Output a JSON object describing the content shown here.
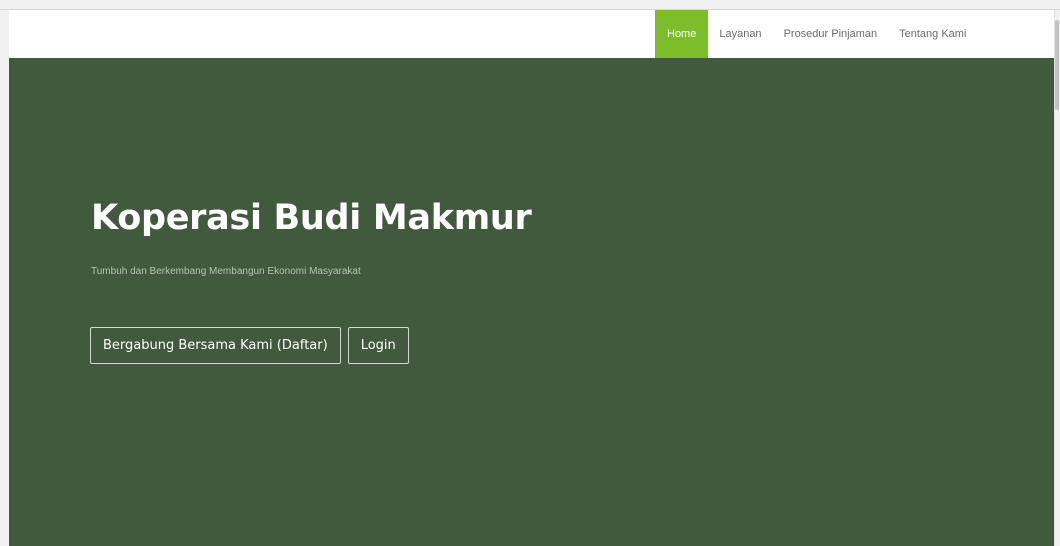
{
  "colors": {
    "hero_background": "#41593c",
    "nav_active_background": "#7dbd2a",
    "navbar_background": "#ffffff"
  },
  "navbar": {
    "items": [
      {
        "label": "Home",
        "active": true
      },
      {
        "label": "Layanan",
        "active": false
      },
      {
        "label": "Prosedur Pinjaman",
        "active": false
      },
      {
        "label": "Tentang Kami",
        "active": false
      }
    ]
  },
  "hero": {
    "title": "Koperasi Budi Makmur",
    "subtitle": "Tumbuh dan Berkembang Membangun Ekonomi Masyarakat",
    "buttons": {
      "register_label": "Bergabung Bersama Kami (Daftar)",
      "login_label": "Login"
    }
  }
}
